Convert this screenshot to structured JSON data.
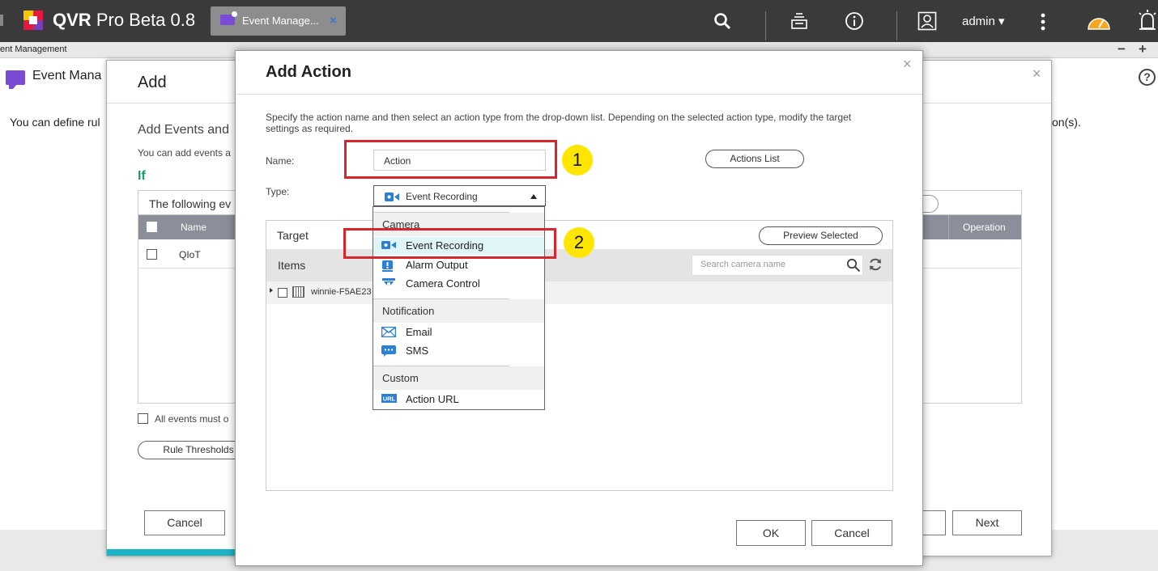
{
  "topbar": {
    "app_name_bold": "QVR",
    "app_name_rest": "Pro Beta 0.8",
    "tab_label": "Event Manage...",
    "tab_close": "×",
    "user": "admin ▾"
  },
  "subbar": {
    "breadcrumb": "ent Management",
    "minimize": "−",
    "maximize": "+"
  },
  "background_page": {
    "title": "Event Mana",
    "description_left": "You can define rul",
    "description_right": "on(s).",
    "help": "?"
  },
  "add_dialog": {
    "title": "Add",
    "close": "×",
    "section_title": "Add Events and",
    "section_desc": "You can add events a",
    "if_label": "If",
    "list_header": "The following ev",
    "col_name": "Name",
    "col_operation": "Operation",
    "row_name": "QIoT",
    "all_events": "All events must o",
    "rule_thresholds": "Rule Thresholds",
    "cancel": "Cancel",
    "next": "Next"
  },
  "add_action": {
    "title": "Add Action",
    "close": "×",
    "description": "Specify the action name and then select an action type from the drop-down list. Depending on the selected action type, modify the target settings as required.",
    "name_label": "Name:",
    "name_value": "Action",
    "type_label": "Type:",
    "type_value": "Event Recording",
    "actions_list": "Actions List",
    "target_label": "Target",
    "preview_selected": "Preview Selected",
    "items_label": "Items",
    "search_placeholder": "Search camera name",
    "tree_item": "winnie-F5AE23",
    "ok": "OK",
    "cancel": "Cancel"
  },
  "annotations": {
    "one": "1",
    "two": "2",
    "color": "#d8262d",
    "badge_color": "#ffe600"
  },
  "dropdown": {
    "groups": [
      {
        "label": "Camera",
        "items": [
          "Event Recording",
          "Alarm Output",
          "Camera Control"
        ]
      },
      {
        "label": "Notification",
        "items": [
          "Email",
          "SMS"
        ]
      },
      {
        "label": "Custom",
        "items": [
          "Action URL"
        ]
      }
    ],
    "selected": "Event Recording"
  },
  "colors": {
    "topbar": "#3a3a3a",
    "accent_teal": "#19b5c7",
    "if_green": "#1a9c6a",
    "icon_blue": "#2b7fd4",
    "event_purple": "#7b4bd6"
  }
}
